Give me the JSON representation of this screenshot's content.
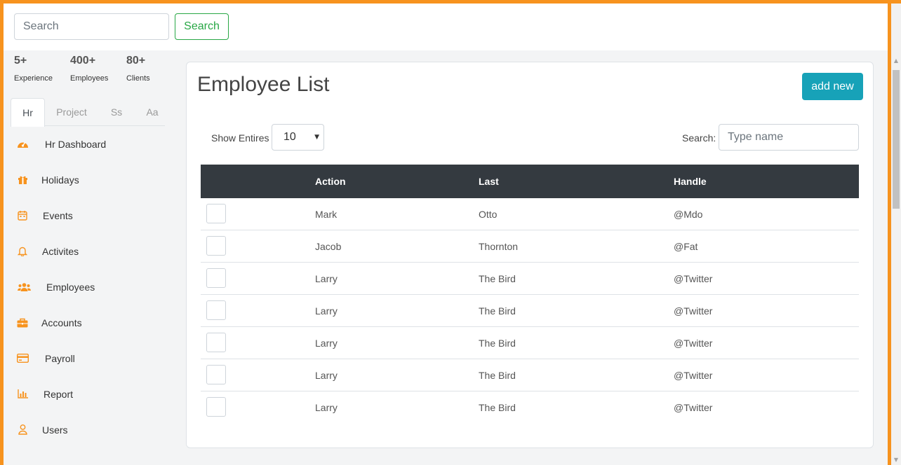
{
  "topbar": {
    "search_placeholder": "Search",
    "search_button": "Search"
  },
  "stats": [
    {
      "value": "5+",
      "label": "Experience"
    },
    {
      "value": "400+",
      "label": "Employees"
    },
    {
      "value": "80+",
      "label": "Clients"
    }
  ],
  "tabs": [
    {
      "label": "Hr",
      "active": true
    },
    {
      "label": "Project",
      "active": false
    },
    {
      "label": "Ss",
      "active": false
    },
    {
      "label": "Aa",
      "active": false
    }
  ],
  "menu": [
    {
      "label": "Hr Dashboard",
      "icon": "dashboard-icon"
    },
    {
      "label": "Holidays",
      "icon": "gift-icon"
    },
    {
      "label": "Events",
      "icon": "calendar-icon"
    },
    {
      "label": "Activites",
      "icon": "bell-icon"
    },
    {
      "label": "Employees",
      "icon": "users-icon"
    },
    {
      "label": "Accounts",
      "icon": "briefcase-icon"
    },
    {
      "label": "Payroll",
      "icon": "credit-card-icon"
    },
    {
      "label": "Report",
      "icon": "bar-chart-icon"
    },
    {
      "label": "Users",
      "icon": "user-icon"
    }
  ],
  "colors": {
    "accent": "#f7931e",
    "add_button": "#17a2b8",
    "search_button": "#28a745",
    "table_header": "#343a40"
  },
  "main": {
    "title": "Employee List",
    "add_button": "add new",
    "show_entries_label": "Show Entires",
    "entries_value": "10",
    "search_label": "Search:",
    "search_placeholder": "Type name",
    "columns": [
      "",
      "Action",
      "Last",
      "Handle"
    ],
    "rows": [
      [
        "Mark",
        "Otto",
        "@Mdo"
      ],
      [
        "Jacob",
        "Thornton",
        "@Fat"
      ],
      [
        "Larry",
        "The Bird",
        "@Twitter"
      ],
      [
        "Larry",
        "The Bird",
        "@Twitter"
      ],
      [
        "Larry",
        "The Bird",
        "@Twitter"
      ],
      [
        "Larry",
        "The Bird",
        "@Twitter"
      ],
      [
        "Larry",
        "The Bird",
        "@Twitter"
      ]
    ]
  }
}
